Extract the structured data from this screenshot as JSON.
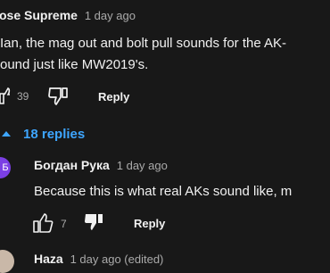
{
  "comments": [
    {
      "author": "ose Supreme",
      "time": "1 day ago",
      "text_lines": [
        "Ian, the mag out and bolt pull sounds for the AK-",
        "ound just like MW2019's."
      ],
      "likes": "39",
      "reply_label": "Reply"
    },
    {
      "author": "Богдан Рука",
      "avatar_letter": "Б",
      "avatar_color": "#7b3fe4",
      "time": "1 day ago",
      "text": "Because this is what real AKs sound like, m",
      "likes": "7",
      "reply_label": "Reply"
    },
    {
      "author": "Haza",
      "time": "1 day ago (edited)"
    }
  ],
  "replies_toggle": "18 replies",
  "colors": {
    "accent": "#3ea6ff",
    "background": "#181818"
  }
}
